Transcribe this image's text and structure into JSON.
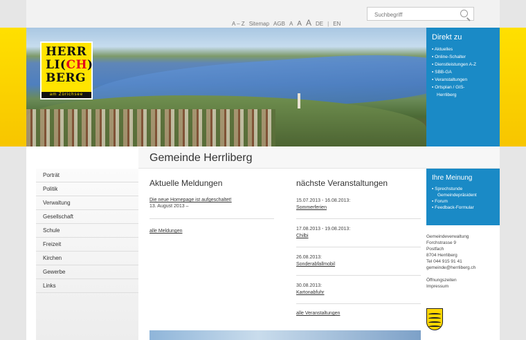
{
  "utilities": {
    "az": "A – Z",
    "sitemap": "Sitemap",
    "agb": "AGB",
    "font_small": "A",
    "font_medium": "A",
    "font_large": "A",
    "lang_de": "DE",
    "lang_sep": "|",
    "lang_en": "EN"
  },
  "search": {
    "placeholder": "Suchbegriff"
  },
  "logo": {
    "line1": "HERR",
    "line2_a": "LI(",
    "line2_ch": "CH",
    "line2_b": ")",
    "line3": "BERG",
    "sub": "am Zürichsee"
  },
  "direkt": {
    "title": "Direkt zu",
    "items": [
      "Aktuelles",
      "Online-Schalter",
      "Dienstleistungen A-Z",
      "SBB-GA",
      "Veranstaltungen",
      "Ortsplan / GIS-",
      "Herrliberg"
    ]
  },
  "page_title": "Gemeinde Herrliberg",
  "nav": {
    "items": [
      "Porträt",
      "Politik",
      "Verwaltung",
      "Gesellschaft",
      "Schule",
      "Freizeit",
      "Kirchen",
      "Gewerbe",
      "Links"
    ]
  },
  "news": {
    "title": "Aktuelle Meldungen",
    "item_link": "Die neue Homepage ist aufgeschaltet!",
    "item_date": "13. August 2013 –",
    "all_link": "alle Meldungen"
  },
  "events": {
    "title": "nächste Veranstaltungen",
    "items": [
      {
        "date": "15.07.2013 - 16.08.2013:",
        "name": "Sommerferien"
      },
      {
        "date": "17.08.2013 - 19.08.2013:",
        "name": "Chilbi"
      },
      {
        "date": "26.08.2013:",
        "name": "Sonderabfallmobil"
      },
      {
        "date": "30.08.2013:",
        "name": "Kartonabfuhr"
      }
    ],
    "all_link": "alle Veranstaltungen"
  },
  "meinung": {
    "title": "Ihre Meinung",
    "item1_a": "Sprechstunde",
    "item1_b": "Gemeindepräsident",
    "item2": "Forum",
    "item3": "Feedback-Formular"
  },
  "contact": {
    "lines": [
      "Gemeindeverwaltung",
      "Forchstrasse 9",
      "Postfach",
      "8704 Herrliberg",
      "Tel 044 915 91 41",
      "gemeinde@herrliberg.ch"
    ],
    "hours": "Öffnungszeiten",
    "impressum": "Impressum"
  },
  "colors": {
    "accent_blue": "#1a8ac6",
    "yellow": "#ffe000",
    "logo_red": "#e3001b"
  }
}
